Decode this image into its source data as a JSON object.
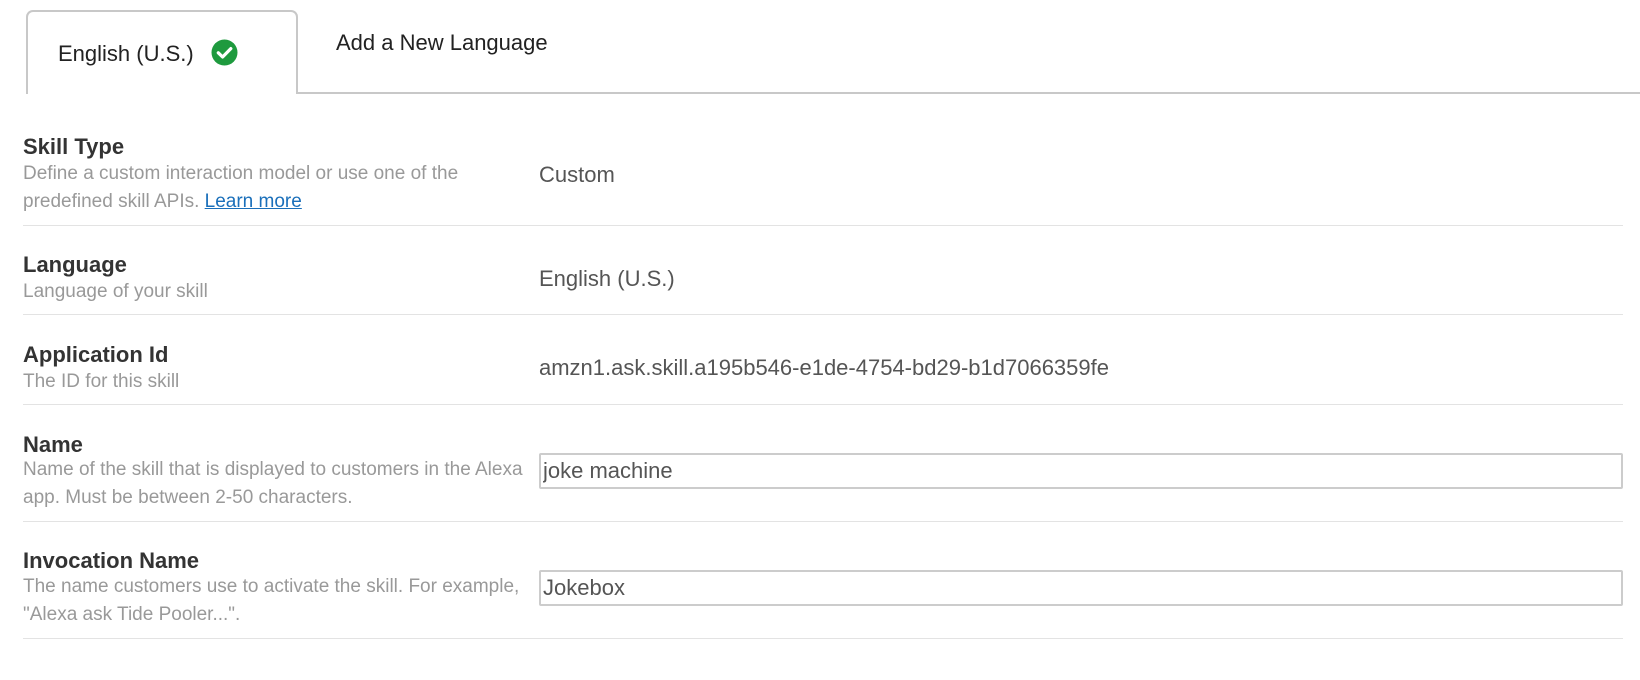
{
  "tabs": {
    "active_label": "English (U.S.)",
    "active_icon": "check-circle-icon",
    "add_label": "Add a New Language",
    "check_color": "#1e9a3e"
  },
  "skill_type": {
    "title": "Skill Type",
    "description": "Define a custom interaction model or use one of the predefined skill APIs.",
    "link_text": "Learn more",
    "value": "Custom"
  },
  "language": {
    "title": "Language",
    "description": "Language of your skill",
    "value": "English (U.S.)"
  },
  "application_id": {
    "title": "Application Id",
    "description": "The ID for this skill",
    "value": "amzn1.ask.skill.a195b546-e1de-4754-bd29-b1d7066359fe"
  },
  "name": {
    "title": "Name",
    "description": "Name of the skill that is displayed to customers in the Alexa app. Must be between 2-50 characters.",
    "value": "joke machine"
  },
  "invocation_name": {
    "title": "Invocation Name",
    "description": "The name customers use to activate the skill. For example, \"Alexa ask Tide Pooler...\".",
    "value": "Jokebox"
  }
}
